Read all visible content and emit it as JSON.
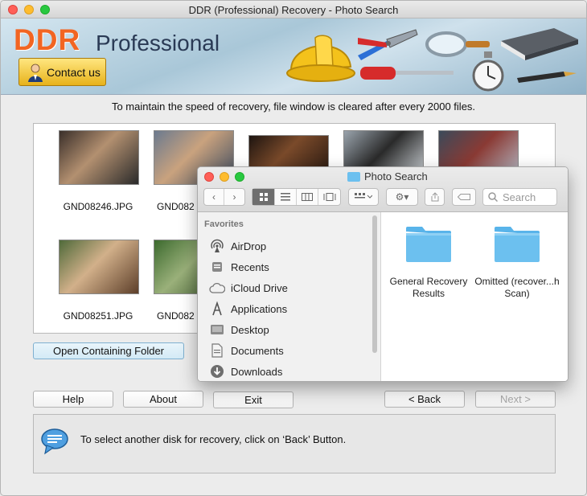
{
  "window": {
    "title": "DDR (Professional) Recovery - Photo Search"
  },
  "banner": {
    "brand_ddr": "DDR",
    "brand_pro": "Professional",
    "contact_label": "Contact us"
  },
  "info_text": "To maintain the speed of recovery, file window is cleared after every 2000 files.",
  "files": [
    {
      "name": "GND08246.JPG",
      "icon": "photo-thumbnail"
    },
    {
      "name": "GND082",
      "icon": "photo-thumbnail"
    },
    {
      "name": "",
      "icon": "photo-thumbnail"
    },
    {
      "name": "",
      "icon": "photo-thumbnail"
    },
    {
      "name": "",
      "icon": "photo-thumbnail"
    },
    {
      "name": "GND08251.JPG",
      "icon": "photo-thumbnail"
    },
    {
      "name": "GND082",
      "icon": "photo-thumbnail"
    }
  ],
  "buttons": {
    "open_folder": "Open Containing Folder",
    "help": "Help",
    "about": "About",
    "exit": "Exit",
    "back": "< Back",
    "next": "Next >"
  },
  "status_text": "To select another disk for recovery, click on ‘Back’ Button.",
  "finder": {
    "title": "Photo Search",
    "search_placeholder": "Search",
    "favorites_header": "Favorites",
    "sidebar": [
      {
        "label": "AirDrop",
        "icon": "airdrop-icon"
      },
      {
        "label": "Recents",
        "icon": "recents-icon"
      },
      {
        "label": "iCloud Drive",
        "icon": "cloud-icon"
      },
      {
        "label": "Applications",
        "icon": "applications-icon"
      },
      {
        "label": "Desktop",
        "icon": "desktop-icon"
      },
      {
        "label": "Documents",
        "icon": "documents-icon"
      },
      {
        "label": "Downloads",
        "icon": "downloads-icon"
      }
    ],
    "folders": [
      {
        "label": "General Recovery Results"
      },
      {
        "label": "Omitted (recover...h Scan)"
      }
    ]
  },
  "colors": {
    "folder_blue": "#6cc0ef",
    "brand_orange": "#f26522",
    "contact_gold": "#e7b21a"
  }
}
